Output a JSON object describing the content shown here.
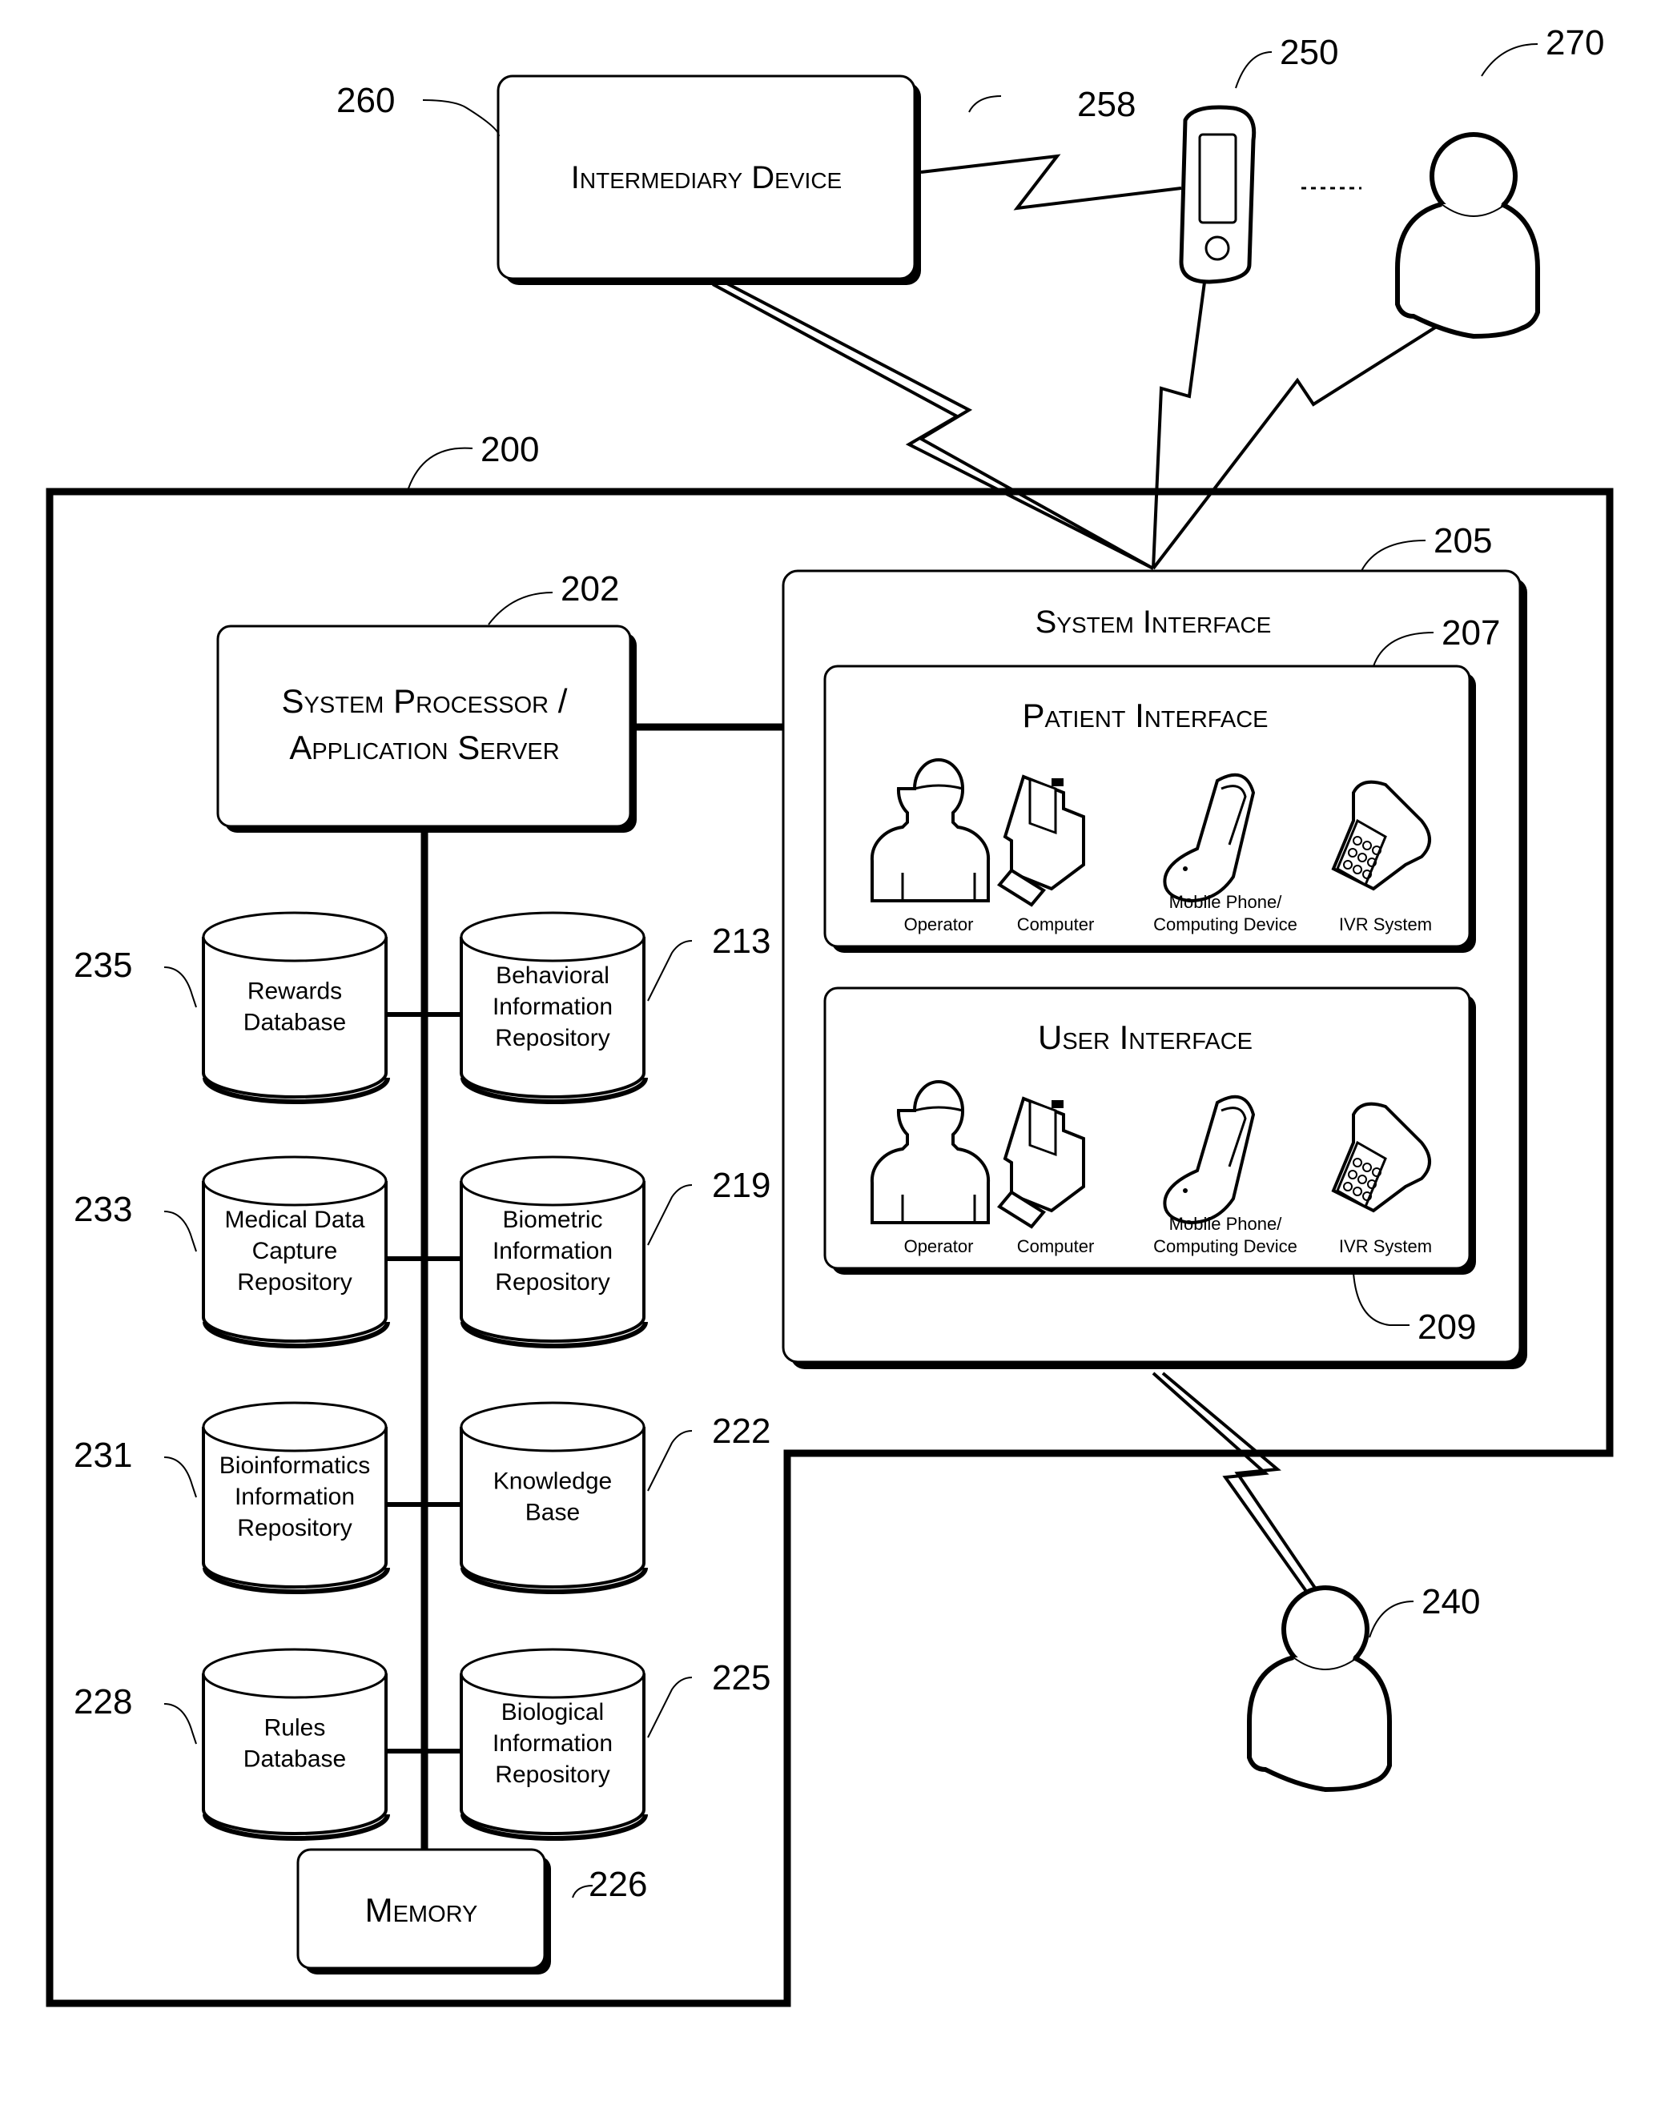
{
  "figure": {
    "system": {
      "ref": "200"
    },
    "intermediary_device": {
      "label": "Intermediary Device",
      "ref": "260"
    },
    "mobile_device": {
      "ref": "250"
    },
    "wireless_link": {
      "ref": "258"
    },
    "remote_user": {
      "ref": "270"
    },
    "user_240": {
      "ref": "240"
    },
    "processor": {
      "line1": "System Processor /",
      "line2": "Application Server",
      "ref": "202"
    },
    "memory": {
      "label": "Memory",
      "ref": "226"
    },
    "system_interface": {
      "title": "System Interface",
      "ref": "205"
    },
    "patient_interface": {
      "title": "Patient Interface",
      "ref": "207",
      "devices": [
        {
          "icon": "operator-icon",
          "label": "Operator"
        },
        {
          "icon": "computer-icon",
          "label": "Computer"
        },
        {
          "icon": "mobile-phone-icon",
          "label1": "Mobile Phone/",
          "label2": "Computing Device"
        },
        {
          "icon": "ivr-phone-icon",
          "label": "IVR System"
        }
      ]
    },
    "user_interface": {
      "title": "User Interface",
      "ref": "209",
      "devices": [
        {
          "icon": "operator-icon",
          "label": "Operator"
        },
        {
          "icon": "computer-icon",
          "label": "Computer"
        },
        {
          "icon": "mobile-phone-icon",
          "label1": "Mobile Phone/",
          "label2": "Computing Device"
        },
        {
          "icon": "ivr-phone-icon",
          "label": "IVR System"
        }
      ]
    },
    "databases": [
      {
        "ref": "235",
        "lines": [
          "Rewards",
          "Database"
        ]
      },
      {
        "ref": "213",
        "lines": [
          "Behavioral",
          "Information",
          "Repository"
        ]
      },
      {
        "ref": "233",
        "lines": [
          "Medical Data",
          "Capture",
          "Repository"
        ]
      },
      {
        "ref": "219",
        "lines": [
          "Biometric",
          "Information",
          "Repository"
        ]
      },
      {
        "ref": "231",
        "lines": [
          "Bioinformatics",
          "Information",
          "Repository"
        ]
      },
      {
        "ref": "222",
        "lines": [
          "Knowledge",
          "Base"
        ]
      },
      {
        "ref": "228",
        "lines": [
          "Rules",
          "Database"
        ]
      },
      {
        "ref": "225",
        "lines": [
          "Biological",
          "Information",
          "Repository"
        ]
      }
    ]
  }
}
